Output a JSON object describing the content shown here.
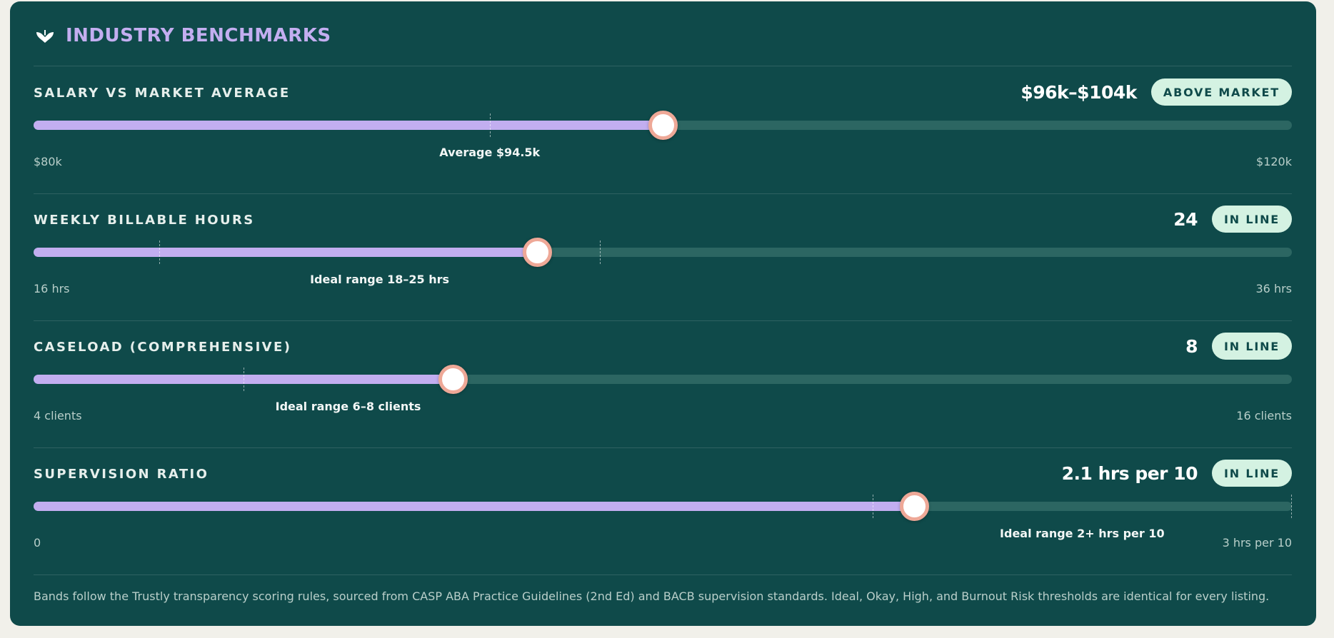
{
  "header": {
    "title": "INDUSTRY BENCHMARKS",
    "icon": "heart-leaf-icon"
  },
  "sections": [
    {
      "label": "SALARY VS MARKET AVERAGE",
      "value": "$96k–$104k",
      "badge": "ABOVE MARKET",
      "min_label": "$80k",
      "max_label": "$120k",
      "marker_label": "Average $94.5k",
      "scale": {
        "min": 80,
        "max": 120
      },
      "current": 100,
      "ticks": [
        94.5
      ],
      "marker_at": 94.5
    },
    {
      "label": "WEEKLY BILLABLE HOURS",
      "value": "24",
      "badge": "IN LINE",
      "min_label": "16 hrs",
      "max_label": "36 hrs",
      "marker_label": "Ideal range 18–25 hrs",
      "scale": {
        "min": 16,
        "max": 36
      },
      "current": 24,
      "ticks": [
        18,
        25
      ],
      "marker_at": 21.5
    },
    {
      "label": "CASELOAD (COMPREHENSIVE)",
      "value": "8",
      "badge": "IN LINE",
      "min_label": "4 clients",
      "max_label": "16 clients",
      "marker_label": "Ideal range 6–8 clients",
      "scale": {
        "min": 4,
        "max": 16
      },
      "current": 8,
      "ticks": [
        6
      ],
      "marker_at": 7
    },
    {
      "label": "SUPERVISION RATIO",
      "value": "2.1 hrs per 10",
      "badge": "IN LINE",
      "min_label": "0",
      "max_label": "3 hrs per 10",
      "marker_label": "Ideal range 2+ hrs per 10",
      "scale": {
        "min": 0,
        "max": 3
      },
      "current": 2.1,
      "ticks": [
        2,
        3
      ],
      "marker_at": 2.5
    }
  ],
  "footer": "Bands follow the Trustly transparency scoring rules, sourced from CASP ABA Practice Guidelines (2nd Ed) and BACB supervision standards. Ideal, Okay, High, and Burnout Risk thresholds are identical for every listing.",
  "colors": {
    "panel": "#0f4a4a",
    "fill": "#c2aef0",
    "track": "#2c6662",
    "thumb_ring": "#eea897",
    "badge_bg": "#d4f2e2",
    "title": "#c3aef0"
  }
}
